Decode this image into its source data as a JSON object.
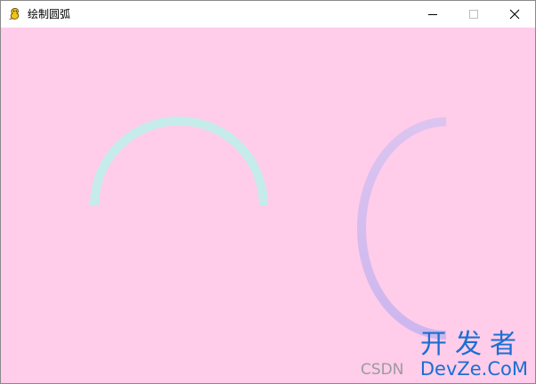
{
  "window": {
    "title": "绘制圆弧",
    "app_icon": "pygame-snake-icon",
    "controls": {
      "minimize": "minimize-icon",
      "maximize": "maximize-icon",
      "close": "close-icon"
    }
  },
  "canvas": {
    "background": "#ffccea",
    "arcs": [
      {
        "name": "upper-semicircle-arc",
        "color": "#c6ecea"
      },
      {
        "name": "left-semicircle-arc",
        "color": "#d8c0ee"
      }
    ]
  },
  "watermark": {
    "top_text": "开发者",
    "csdn_text": "CSDN",
    "bottom_text": "DevZe.CoM"
  }
}
